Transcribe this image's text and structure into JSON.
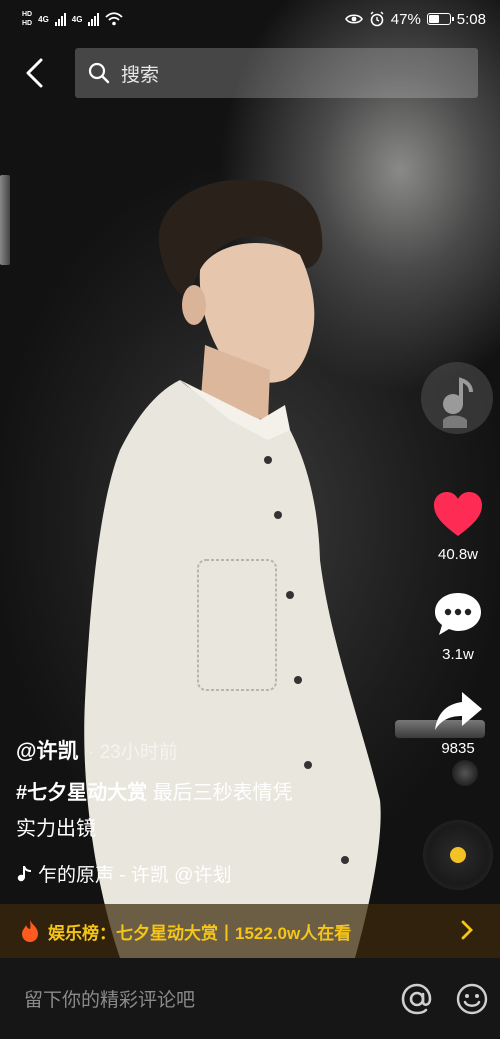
{
  "status_bar": {
    "network_top": "HD",
    "network_bottom": "HD",
    "signal_label_1": "4G",
    "signal_label_2": "4G",
    "battery": "47%",
    "time": "5:08"
  },
  "search": {
    "placeholder": "搜索"
  },
  "actions": {
    "likes": "40.8w",
    "comments": "3.1w",
    "shares": "9835"
  },
  "video": {
    "author": "@许凯",
    "time_ago": "· 23小时前",
    "hashtag": "#七夕星动大赏",
    "caption_line1": "最后三秒表情凭",
    "caption_line2": "实力出镜",
    "music": "乍的原声 - 许凯    @许刬"
  },
  "hot_banner": {
    "text": "娱乐榜：七夕星动大赏丨1522.0w人在看"
  },
  "comment": {
    "placeholder": "留下你的精彩评论吧"
  },
  "colors": {
    "like": "#fe2c55",
    "hot": "#f5c518",
    "disc_dot": "#f3c326"
  }
}
